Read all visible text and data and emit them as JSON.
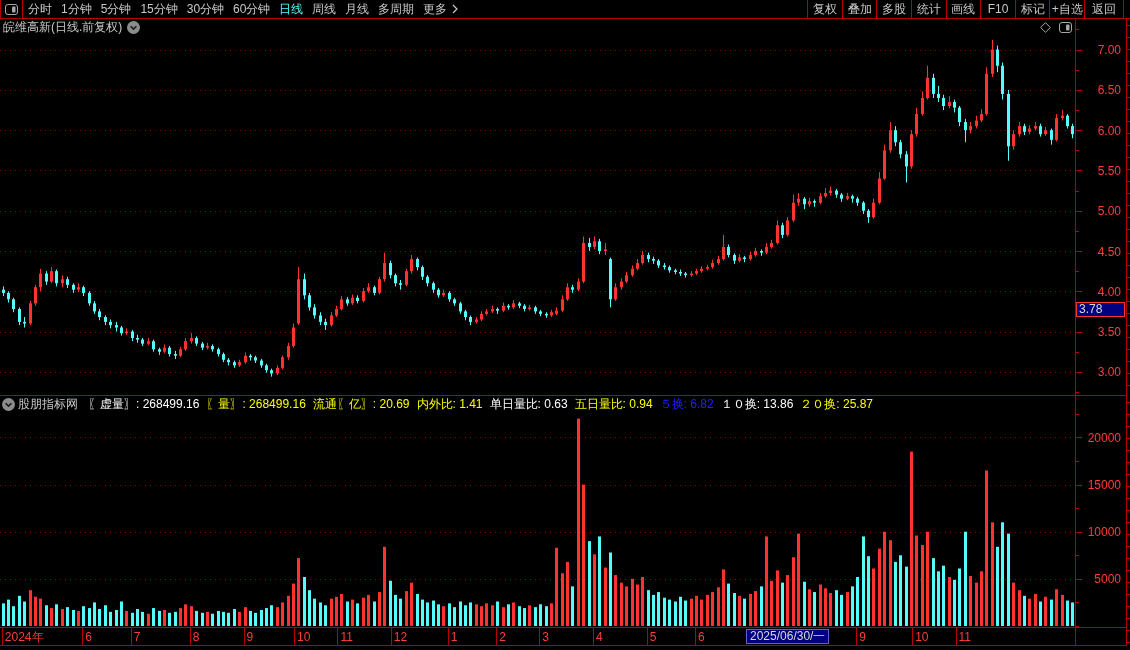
{
  "toolbar": {
    "periods": [
      {
        "label": "分时",
        "selected": false
      },
      {
        "label": "1分钟",
        "selected": false
      },
      {
        "label": "5分钟",
        "selected": false
      },
      {
        "label": "15分钟",
        "selected": false
      },
      {
        "label": "30分钟",
        "selected": false
      },
      {
        "label": "60分钟",
        "selected": false
      },
      {
        "label": "日线",
        "selected": true
      },
      {
        "label": "周线",
        "selected": false
      },
      {
        "label": "月线",
        "selected": false
      },
      {
        "label": "多周期",
        "selected": false
      }
    ],
    "more_menu": {
      "label": "更多"
    },
    "actions": [
      "复权",
      "叠加",
      "多股",
      "统计",
      "画线",
      "F10",
      "标记",
      "+自选",
      "返回"
    ]
  },
  "price_pane": {
    "title": "皖维高新(日线.前复权)",
    "cursor_label": "3.78",
    "chart_data": {
      "type": "candlestick",
      "tick_labels": "y",
      "grid": true,
      "ylim": [
        2.7,
        7.38
      ],
      "yticks": [
        {
          "value": 3,
          "label": "3.00"
        },
        {
          "value": 3.5,
          "label": "3.50"
        },
        {
          "value": 4,
          "label": "4.00"
        },
        {
          "value": 4.5,
          "label": "4.50"
        },
        {
          "value": 5,
          "label": "5.00"
        },
        {
          "value": 5.5,
          "label": "5.50"
        },
        {
          "value": 6,
          "label": "6.00"
        },
        {
          "value": 6.5,
          "label": "6.50"
        },
        {
          "value": 7,
          "label": "7.00"
        }
      ],
      "ohlc": [
        [
          4.02,
          4.06,
          3.94,
          3.98
        ],
        [
          3.98,
          4.0,
          3.86,
          3.9
        ],
        [
          3.9,
          3.92,
          3.74,
          3.78
        ],
        [
          3.78,
          3.8,
          3.58,
          3.62
        ],
        [
          3.62,
          3.68,
          3.55,
          3.6
        ],
        [
          3.6,
          3.88,
          3.58,
          3.85
        ],
        [
          3.85,
          4.08,
          3.82,
          4.05
        ],
        [
          4.05,
          4.28,
          4.0,
          4.22
        ],
        [
          4.22,
          4.25,
          4.08,
          4.12
        ],
        [
          4.12,
          4.3,
          4.1,
          4.25
        ],
        [
          4.25,
          4.27,
          4.06,
          4.1
        ],
        [
          4.1,
          4.2,
          4.05,
          4.15
        ],
        [
          4.15,
          4.18,
          4.04,
          4.08
        ],
        [
          4.08,
          4.1,
          3.98,
          4.02
        ],
        [
          4.02,
          4.1,
          3.99,
          4.05
        ],
        [
          4.05,
          4.07,
          3.94,
          3.98
        ],
        [
          3.98,
          4.0,
          3.82,
          3.85
        ],
        [
          3.85,
          3.88,
          3.72,
          3.75
        ],
        [
          3.75,
          3.78,
          3.64,
          3.68
        ],
        [
          3.68,
          3.7,
          3.58,
          3.62
        ],
        [
          3.62,
          3.65,
          3.54,
          3.58
        ],
        [
          3.58,
          3.62,
          3.5,
          3.55
        ],
        [
          3.55,
          3.57,
          3.45,
          3.48
        ],
        [
          3.48,
          3.54,
          3.46,
          3.5
        ],
        [
          3.5,
          3.52,
          3.38,
          3.42
        ],
        [
          3.42,
          3.46,
          3.36,
          3.4
        ],
        [
          3.4,
          3.42,
          3.32,
          3.35
        ],
        [
          3.35,
          3.42,
          3.33,
          3.38
        ],
        [
          3.38,
          3.4,
          3.25,
          3.28
        ],
        [
          3.28,
          3.3,
          3.21,
          3.25
        ],
        [
          3.25,
          3.34,
          3.23,
          3.3
        ],
        [
          3.3,
          3.32,
          3.19,
          3.22
        ],
        [
          3.22,
          3.26,
          3.16,
          3.2
        ],
        [
          3.2,
          3.31,
          3.18,
          3.28
        ],
        [
          3.28,
          3.42,
          3.26,
          3.38
        ],
        [
          3.38,
          3.48,
          3.35,
          3.42
        ],
        [
          3.42,
          3.44,
          3.32,
          3.35
        ],
        [
          3.35,
          3.37,
          3.27,
          3.3
        ],
        [
          3.3,
          3.36,
          3.28,
          3.32
        ],
        [
          3.32,
          3.34,
          3.25,
          3.28
        ],
        [
          3.28,
          3.3,
          3.19,
          3.22
        ],
        [
          3.22,
          3.24,
          3.12,
          3.15
        ],
        [
          3.15,
          3.17,
          3.08,
          3.12
        ],
        [
          3.12,
          3.14,
          3.05,
          3.08
        ],
        [
          3.08,
          3.15,
          3.06,
          3.12
        ],
        [
          3.12,
          3.24,
          3.1,
          3.2
        ],
        [
          3.2,
          3.22,
          3.14,
          3.18
        ],
        [
          3.18,
          3.2,
          3.11,
          3.14
        ],
        [
          3.14,
          3.16,
          3.05,
          3.08
        ],
        [
          3.08,
          3.1,
          2.99,
          3.02
        ],
        [
          3.02,
          3.04,
          2.94,
          2.98
        ],
        [
          2.98,
          3.08,
          2.96,
          3.05
        ],
        [
          3.05,
          3.2,
          3.03,
          3.18
        ],
        [
          3.18,
          3.36,
          3.15,
          3.32
        ],
        [
          3.32,
          3.6,
          3.3,
          3.55
        ],
        [
          3.6,
          4.3,
          3.58,
          4.15
        ],
        [
          4.15,
          4.22,
          3.9,
          3.95
        ],
        [
          3.95,
          3.98,
          3.76,
          3.8
        ],
        [
          3.8,
          3.84,
          3.66,
          3.7
        ],
        [
          3.7,
          3.74,
          3.58,
          3.62
        ],
        [
          3.62,
          3.66,
          3.52,
          3.58
        ],
        [
          3.58,
          3.74,
          3.56,
          3.7
        ],
        [
          3.7,
          3.82,
          3.68,
          3.78
        ],
        [
          3.78,
          3.94,
          3.76,
          3.9
        ],
        [
          3.9,
          3.93,
          3.82,
          3.85
        ],
        [
          3.85,
          3.96,
          3.83,
          3.92
        ],
        [
          3.92,
          3.95,
          3.85,
          3.88
        ],
        [
          3.88,
          4.04,
          3.86,
          4.0
        ],
        [
          4.0,
          4.1,
          3.98,
          4.05
        ],
        [
          4.05,
          4.07,
          3.95,
          3.98
        ],
        [
          3.98,
          4.18,
          3.96,
          4.15
        ],
        [
          4.15,
          4.48,
          4.12,
          4.35
        ],
        [
          4.35,
          4.38,
          4.16,
          4.2
        ],
        [
          4.2,
          4.22,
          4.06,
          4.1
        ],
        [
          4.1,
          4.14,
          4.02,
          4.08
        ],
        [
          4.08,
          4.28,
          4.06,
          4.25
        ],
        [
          4.25,
          4.45,
          4.22,
          4.4
        ],
        [
          4.4,
          4.42,
          4.26,
          4.3
        ],
        [
          4.3,
          4.32,
          4.14,
          4.18
        ],
        [
          4.18,
          4.2,
          4.06,
          4.1
        ],
        [
          4.1,
          4.12,
          3.98,
          4.02
        ],
        [
          4.02,
          4.04,
          3.92,
          3.95
        ],
        [
          3.95,
          4.02,
          3.93,
          3.98
        ],
        [
          3.98,
          4.0,
          3.87,
          3.9
        ],
        [
          3.9,
          3.92,
          3.82,
          3.85
        ],
        [
          3.85,
          3.87,
          3.72,
          3.75
        ],
        [
          3.75,
          3.77,
          3.64,
          3.68
        ],
        [
          3.68,
          3.7,
          3.58,
          3.62
        ],
        [
          3.62,
          3.68,
          3.6,
          3.65
        ],
        [
          3.65,
          3.75,
          3.63,
          3.72
        ],
        [
          3.72,
          3.78,
          3.7,
          3.75
        ],
        [
          3.75,
          3.82,
          3.73,
          3.78
        ],
        [
          3.78,
          3.8,
          3.72,
          3.76
        ],
        [
          3.76,
          3.86,
          3.74,
          3.82
        ],
        [
          3.82,
          3.84,
          3.77,
          3.8
        ],
        [
          3.8,
          3.89,
          3.78,
          3.85
        ],
        [
          3.85,
          3.87,
          3.79,
          3.82
        ],
        [
          3.82,
          3.84,
          3.75,
          3.78
        ],
        [
          3.78,
          3.83,
          3.76,
          3.8
        ],
        [
          3.8,
          3.82,
          3.72,
          3.75
        ],
        [
          3.75,
          3.77,
          3.69,
          3.72
        ],
        [
          3.72,
          3.74,
          3.67,
          3.7
        ],
        [
          3.7,
          3.77,
          3.68,
          3.74
        ],
        [
          3.72,
          3.8,
          3.7,
          3.76
        ],
        [
          3.76,
          3.95,
          3.74,
          3.9
        ],
        [
          3.9,
          4.1,
          3.88,
          4.05
        ],
        [
          4.05,
          4.08,
          3.98,
          4.02
        ],
        [
          4.02,
          4.16,
          4.0,
          4.12
        ],
        [
          4.12,
          4.68,
          4.1,
          4.6
        ],
        [
          4.6,
          4.66,
          4.5,
          4.55
        ],
        [
          4.55,
          4.68,
          4.52,
          4.62
        ],
        [
          4.62,
          4.65,
          4.46,
          4.5
        ],
        [
          4.5,
          4.6,
          4.45,
          4.52
        ],
        [
          4.4,
          4.42,
          3.8,
          3.9
        ],
        [
          3.9,
          4.1,
          3.88,
          4.05
        ],
        [
          4.05,
          4.16,
          4.02,
          4.12
        ],
        [
          4.12,
          4.24,
          4.1,
          4.2
        ],
        [
          4.2,
          4.32,
          4.18,
          4.28
        ],
        [
          4.28,
          4.4,
          4.26,
          4.35
        ],
        [
          4.35,
          4.5,
          4.33,
          4.45
        ],
        [
          4.45,
          4.48,
          4.36,
          4.4
        ],
        [
          4.4,
          4.43,
          4.34,
          4.38
        ],
        [
          4.38,
          4.4,
          4.29,
          4.32
        ],
        [
          4.32,
          4.35,
          4.27,
          4.3
        ],
        [
          4.3,
          4.32,
          4.23,
          4.26
        ],
        [
          4.26,
          4.28,
          4.21,
          4.24
        ],
        [
          4.24,
          4.27,
          4.19,
          4.22
        ],
        [
          4.22,
          4.24,
          4.17,
          4.2
        ],
        [
          4.2,
          4.25,
          4.18,
          4.22
        ],
        [
          4.22,
          4.28,
          4.2,
          4.25
        ],
        [
          4.25,
          4.31,
          4.23,
          4.28
        ],
        [
          4.28,
          4.33,
          4.26,
          4.3
        ],
        [
          4.3,
          4.39,
          4.28,
          4.35
        ],
        [
          4.35,
          4.44,
          4.33,
          4.4
        ],
        [
          4.4,
          4.7,
          4.38,
          4.55
        ],
        [
          4.55,
          4.58,
          4.42,
          4.45
        ],
        [
          4.45,
          4.47,
          4.34,
          4.38
        ],
        [
          4.38,
          4.46,
          4.36,
          4.42
        ],
        [
          4.42,
          4.44,
          4.36,
          4.4
        ],
        [
          4.4,
          4.49,
          4.38,
          4.45
        ],
        [
          4.45,
          4.54,
          4.43,
          4.5
        ],
        [
          4.5,
          4.52,
          4.44,
          4.48
        ],
        [
          4.48,
          4.6,
          4.46,
          4.55
        ],
        [
          4.55,
          4.64,
          4.53,
          4.6
        ],
        [
          4.6,
          4.88,
          4.58,
          4.82
        ],
        [
          4.82,
          4.85,
          4.66,
          4.7
        ],
        [
          4.7,
          4.92,
          4.68,
          4.88
        ],
        [
          4.88,
          5.2,
          4.86,
          5.1
        ],
        [
          5.1,
          5.22,
          5.06,
          5.15
        ],
        [
          5.15,
          5.17,
          5.02,
          5.08
        ],
        [
          5.08,
          5.16,
          5.05,
          5.12
        ],
        [
          5.12,
          5.14,
          5.05,
          5.1
        ],
        [
          5.1,
          5.22,
          5.08,
          5.18
        ],
        [
          5.18,
          5.28,
          5.16,
          5.22
        ],
        [
          5.22,
          5.3,
          5.19,
          5.25
        ],
        [
          5.25,
          5.27,
          5.16,
          5.2
        ],
        [
          5.2,
          5.22,
          5.11,
          5.15
        ],
        [
          5.15,
          5.22,
          5.13,
          5.18
        ],
        [
          5.18,
          5.2,
          5.1,
          5.15
        ],
        [
          5.15,
          5.17,
          5.06,
          5.1
        ],
        [
          5.1,
          5.12,
          4.96,
          5.0
        ],
        [
          5.0,
          5.02,
          4.85,
          4.92
        ],
        [
          4.92,
          5.15,
          4.9,
          5.1
        ],
        [
          5.1,
          5.48,
          5.08,
          5.4
        ],
        [
          5.4,
          5.82,
          5.38,
          5.75
        ],
        [
          5.75,
          6.1,
          5.72,
          6.0
        ],
        [
          6.0,
          6.05,
          5.8,
          5.85
        ],
        [
          5.85,
          5.88,
          5.65,
          5.7
        ],
        [
          5.7,
          5.74,
          5.35,
          5.55
        ],
        [
          5.55,
          6.0,
          5.52,
          5.95
        ],
        [
          5.95,
          6.28,
          5.92,
          6.2
        ],
        [
          6.2,
          6.48,
          6.18,
          6.4
        ],
        [
          6.4,
          6.8,
          6.38,
          6.65
        ],
        [
          6.65,
          6.7,
          6.4,
          6.45
        ],
        [
          6.45,
          6.55,
          6.35,
          6.4
        ],
        [
          6.4,
          6.44,
          6.25,
          6.3
        ],
        [
          6.3,
          6.42,
          6.27,
          6.35
        ],
        [
          6.35,
          6.38,
          6.22,
          6.28
        ],
        [
          6.28,
          6.3,
          6.05,
          6.1
        ],
        [
          6.1,
          6.14,
          5.85,
          6.0
        ],
        [
          6.0,
          6.1,
          5.96,
          6.05
        ],
        [
          6.05,
          6.18,
          6.02,
          6.12
        ],
        [
          6.12,
          6.26,
          6.1,
          6.2
        ],
        [
          6.2,
          6.78,
          6.18,
          6.7
        ],
        [
          6.7,
          7.12,
          6.66,
          7.0
        ],
        [
          7.0,
          7.05,
          6.72,
          6.8
        ],
        [
          6.8,
          6.84,
          6.38,
          6.45
        ],
        [
          6.45,
          6.5,
          5.62,
          5.8
        ],
        [
          5.8,
          6.0,
          5.76,
          5.95
        ],
        [
          5.95,
          6.1,
          5.92,
          6.05
        ],
        [
          6.05,
          6.08,
          5.94,
          5.98
        ],
        [
          5.98,
          6.06,
          5.95,
          6.02
        ],
        [
          6.02,
          6.1,
          6.0,
          6.05
        ],
        [
          6.05,
          6.08,
          5.92,
          5.95
        ],
        [
          5.95,
          6.04,
          5.93,
          6.0
        ],
        [
          6.0,
          6.02,
          5.82,
          5.88
        ],
        [
          5.88,
          6.2,
          5.86,
          6.15
        ],
        [
          6.15,
          6.25,
          6.12,
          6.18
        ],
        [
          6.18,
          6.2,
          6.02,
          6.05
        ],
        [
          6.05,
          6.08,
          5.9,
          5.95
        ]
      ]
    }
  },
  "volume_pane": {
    "indicator": "股朋指标网",
    "readouts": [
      {
        "text": "〖虚量〗: 268499.16",
        "color": "#ffffff"
      },
      {
        "text": "〖量〗: 268499.16",
        "color": "#ffff00"
      },
      {
        "text": "流通〖亿〗: 20.69",
        "color": "#ffff00"
      },
      {
        "text": "内外比: 1.41",
        "color": "#ffff00"
      },
      {
        "text": "单日量比: 0.63",
        "color": "#ffffff"
      },
      {
        "text": "五日量比: 0.94",
        "color": "#ffff00"
      },
      {
        "text": "５换: 6.82",
        "color": "#2020ff"
      },
      {
        "text": "１０换: 13.86",
        "color": "#ffffff"
      },
      {
        "text": "２０换: 25.87",
        "color": "#ffff00"
      }
    ],
    "cursor_label": "2025/06/30/一",
    "chart_data": {
      "type": "bar",
      "grid": true,
      "ylim": [
        0,
        24400
      ],
      "yticks": [
        5000,
        10000,
        15000,
        20000
      ],
      "categories": [
        null,
        null,
        null,
        null,
        "2024年",
        null,
        null,
        null,
        null,
        null,
        null,
        null,
        null,
        null,
        null,
        null,
        "6",
        null,
        null,
        null,
        null,
        null,
        null,
        null,
        null,
        "7",
        null,
        null,
        null,
        null,
        null,
        null,
        null,
        null,
        null,
        null,
        "8",
        null,
        null,
        null,
        null,
        null,
        null,
        null,
        null,
        null,
        "9",
        null,
        null,
        null,
        null,
        null,
        null,
        null,
        null,
        null,
        "10",
        null,
        null,
        null,
        null,
        null,
        null,
        null,
        "11",
        null,
        null,
        null,
        null,
        null,
        null,
        null,
        null,
        null,
        "12",
        null,
        null,
        null,
        null,
        null,
        null,
        null,
        null,
        null,
        "1",
        null,
        null,
        null,
        null,
        null,
        null,
        null,
        null,
        "2",
        null,
        null,
        null,
        null,
        null,
        null,
        null,
        "3",
        null,
        null,
        null,
        null,
        null,
        null,
        null,
        null,
        null,
        "4",
        null,
        null,
        null,
        null,
        null,
        null,
        null,
        null,
        null,
        "5",
        null,
        null,
        null,
        null,
        null,
        null,
        null,
        null,
        "6",
        null,
        null,
        null,
        null,
        null,
        null,
        null,
        null,
        null,
        null,
        null,
        null,
        null,
        null,
        null,
        null,
        null,
        null,
        null,
        null,
        null,
        null,
        null,
        null,
        null,
        null,
        null,
        null,
        null,
        "9",
        null,
        null,
        null,
        null,
        null,
        null,
        null,
        null,
        null,
        null,
        "10",
        null,
        null,
        null,
        null,
        null,
        null,
        null,
        "11",
        null,
        null,
        null,
        null,
        null,
        null,
        null,
        null,
        null,
        null,
        null,
        null,
        null,
        null,
        null,
        null,
        null,
        null,
        null,
        null
      ],
      "values": [
        2400,
        2800,
        2100,
        3200,
        2600,
        3800,
        3100,
        2900,
        2200,
        1900,
        2300,
        1800,
        2000,
        1700,
        1600,
        2100,
        1900,
        2500,
        1800,
        2200,
        1500,
        1700,
        2600,
        1600,
        1400,
        1800,
        1500,
        1300,
        1900,
        1600,
        1700,
        1400,
        1500,
        1900,
        2300,
        2100,
        1600,
        1400,
        1500,
        1300,
        1600,
        1500,
        1400,
        1800,
        1500,
        2000,
        1600,
        1400,
        1700,
        1900,
        2200,
        2000,
        2500,
        3200,
        4500,
        7200,
        5200,
        3800,
        2900,
        2500,
        2200,
        2900,
        3100,
        3400,
        2600,
        2800,
        2400,
        3000,
        3300,
        2600,
        3600,
        8400,
        4800,
        3300,
        2900,
        3700,
        4600,
        3400,
        2800,
        2500,
        2700,
        2300,
        2100,
        2400,
        2000,
        2600,
        2200,
        2500,
        2300,
        2100,
        2400,
        2200,
        2600,
        2000,
        2300,
        2500,
        2100,
        1900,
        2200,
        2000,
        2300,
        2100,
        2400,
        8300,
        5600,
        6800,
        4200,
        22000,
        15000,
        9000,
        7600,
        9500,
        6200,
        7800,
        5400,
        4600,
        4200,
        5000,
        4400,
        5200,
        3800,
        3300,
        3600,
        3000,
        2800,
        2600,
        3100,
        2700,
        2900,
        3200,
        2800,
        3300,
        3600,
        4100,
        6000,
        4500,
        3500,
        3200,
        2900,
        3400,
        3700,
        4200,
        9500,
        4800,
        5900,
        4600,
        5400,
        7300,
        9800,
        4700,
        3900,
        3600,
        4400,
        4000,
        3500,
        3800,
        3300,
        3600,
        4200,
        5200,
        9500,
        7400,
        6100,
        8200,
        10000,
        9100,
        6800,
        7500,
        6300,
        18500,
        9600,
        8600,
        10000,
        7200,
        5800,
        6400,
        5200,
        4900,
        6100,
        10000,
        5300,
        4600,
        5800,
        16500,
        11000,
        8400,
        11000,
        9800,
        4600,
        3800,
        3200,
        2900,
        3400,
        2600,
        3100,
        2800,
        3900,
        3300,
        2700,
        2500
      ],
      "colors": [
        "#54fcfc",
        "#54fcfc",
        "#54fcfc",
        "#54fcfc",
        "#54fcfc",
        "#ff3232",
        "#ff3232",
        "#ff3232",
        "#54fcfc",
        "#ff3232",
        "#54fcfc",
        "#ff3232",
        "#54fcfc",
        "#54fcfc",
        "#ff3232",
        "#54fcfc",
        "#54fcfc",
        "#54fcfc",
        "#54fcfc",
        "#54fcfc",
        "#54fcfc",
        "#54fcfc",
        "#54fcfc",
        "#ff3232",
        "#54fcfc",
        "#54fcfc",
        "#54fcfc",
        "#ff3232",
        "#54fcfc",
        "#54fcfc",
        "#ff3232",
        "#54fcfc",
        "#54fcfc",
        "#ff3232",
        "#ff3232",
        "#ff3232",
        "#54fcfc",
        "#54fcfc",
        "#ff3232",
        "#54fcfc",
        "#54fcfc",
        "#54fcfc",
        "#54fcfc",
        "#54fcfc",
        "#ff3232",
        "#ff3232",
        "#54fcfc",
        "#54fcfc",
        "#54fcfc",
        "#54fcfc",
        "#54fcfc",
        "#ff3232",
        "#ff3232",
        "#ff3232",
        "#ff3232",
        "#ff3232",
        "#54fcfc",
        "#54fcfc",
        "#54fcfc",
        "#54fcfc",
        "#54fcfc",
        "#ff3232",
        "#ff3232",
        "#ff3232",
        "#54fcfc",
        "#ff3232",
        "#54fcfc",
        "#ff3232",
        "#ff3232",
        "#54fcfc",
        "#ff3232",
        "#ff3232",
        "#54fcfc",
        "#54fcfc",
        "#54fcfc",
        "#ff3232",
        "#ff3232",
        "#54fcfc",
        "#54fcfc",
        "#54fcfc",
        "#54fcfc",
        "#54fcfc",
        "#ff3232",
        "#54fcfc",
        "#54fcfc",
        "#54fcfc",
        "#54fcfc",
        "#54fcfc",
        "#ff3232",
        "#ff3232",
        "#ff3232",
        "#ff3232",
        "#54fcfc",
        "#ff3232",
        "#54fcfc",
        "#ff3232",
        "#54fcfc",
        "#54fcfc",
        "#ff3232",
        "#54fcfc",
        "#54fcfc",
        "#54fcfc",
        "#ff3232",
        "#ff3232",
        "#ff3232",
        "#ff3232",
        "#54fcfc",
        "#ff3232",
        "#ff3232",
        "#54fcfc",
        "#ff3232",
        "#54fcfc",
        "#ff3232",
        "#54fcfc",
        "#ff3232",
        "#ff3232",
        "#ff3232",
        "#ff3232",
        "#ff3232",
        "#ff3232",
        "#54fcfc",
        "#54fcfc",
        "#54fcfc",
        "#54fcfc",
        "#54fcfc",
        "#54fcfc",
        "#54fcfc",
        "#54fcfc",
        "#ff3232",
        "#ff3232",
        "#ff3232",
        "#ff3232",
        "#ff3232",
        "#ff3232",
        "#ff3232",
        "#54fcfc",
        "#54fcfc",
        "#ff3232",
        "#54fcfc",
        "#ff3232",
        "#ff3232",
        "#54fcfc",
        "#ff3232",
        "#ff3232",
        "#ff3232",
        "#54fcfc",
        "#ff3232",
        "#ff3232",
        "#ff3232",
        "#54fcfc",
        "#ff3232",
        "#54fcfc",
        "#ff3232",
        "#ff3232",
        "#ff3232",
        "#54fcfc",
        "#54fcfc",
        "#ff3232",
        "#54fcfc",
        "#54fcfc",
        "#54fcfc",
        "#54fcfc",
        "#ff3232",
        "#ff3232",
        "#ff3232",
        "#ff3232",
        "#54fcfc",
        "#54fcfc",
        "#54fcfc",
        "#ff3232",
        "#ff3232",
        "#ff3232",
        "#ff3232",
        "#54fcfc",
        "#54fcfc",
        "#54fcfc",
        "#ff3232",
        "#54fcfc",
        "#54fcfc",
        "#54fcfc",
        "#ff3232",
        "#ff3232",
        "#ff3232",
        "#ff3232",
        "#ff3232",
        "#54fcfc",
        "#54fcfc",
        "#54fcfc",
        "#ff3232",
        "#ff3232",
        "#54fcfc",
        "#ff3232",
        "#ff3232",
        "#54fcfc",
        "#ff3232",
        "#54fcfc",
        "#ff3232",
        "#ff3232",
        "#54fcfc",
        "#54fcfc"
      ]
    }
  }
}
